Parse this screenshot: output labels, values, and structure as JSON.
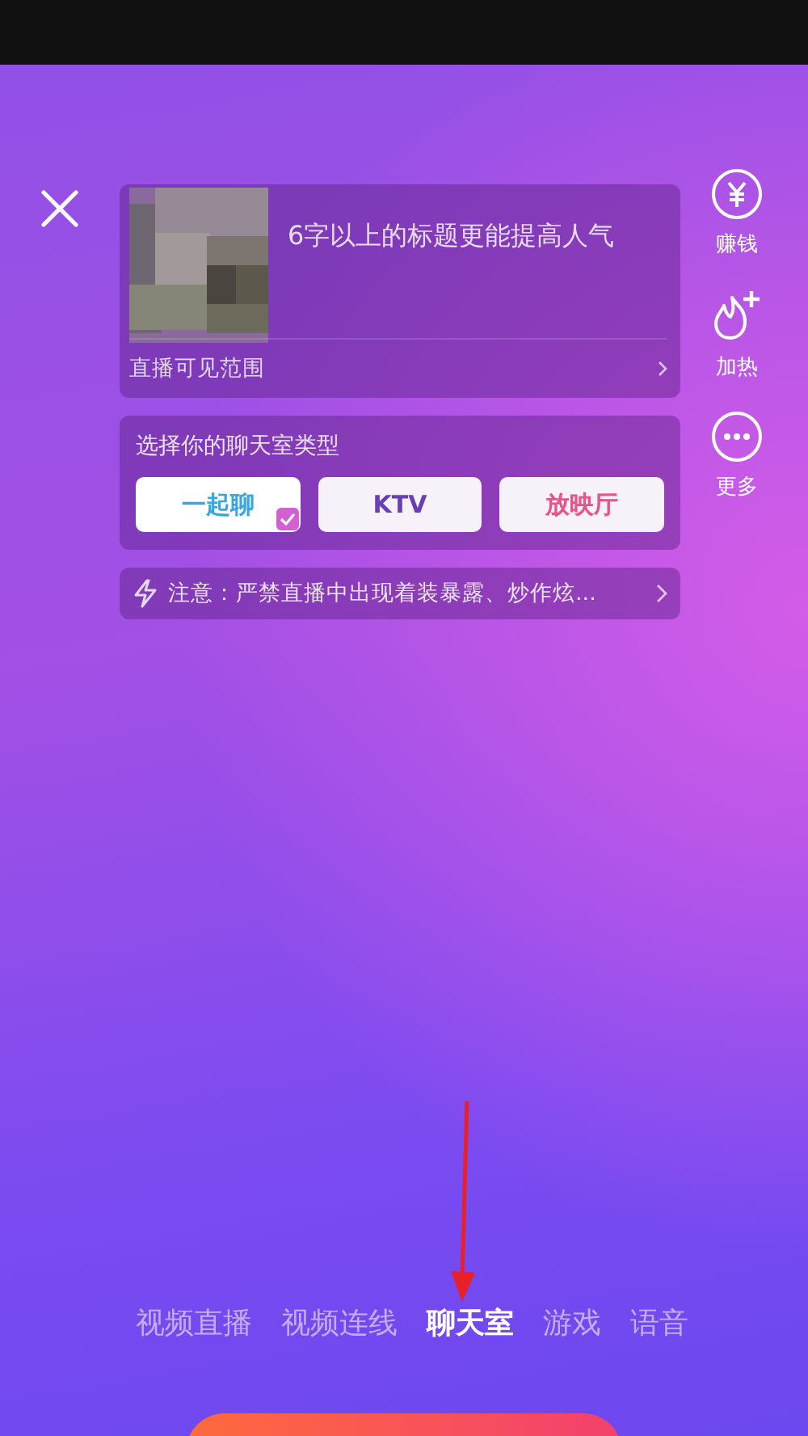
{
  "title_placeholder": "6字以上的标题更能提高人气",
  "visibility_label": "直播可见范围",
  "chat_type": {
    "heading": "选择你的聊天室类型",
    "options": [
      {
        "label": "一起聊",
        "color": "#3aa6dd",
        "selected": true
      },
      {
        "label": "KTV",
        "color": "#6a3fb5",
        "selected": false
      },
      {
        "label": "放映厅",
        "color": "#e8538a",
        "selected": false
      }
    ]
  },
  "notice": "注意：严禁直播中出现着装暴露、炒作炫...",
  "side_actions": [
    {
      "kind": "money",
      "label": "赚钱"
    },
    {
      "kind": "boost",
      "label": "加热"
    },
    {
      "kind": "more",
      "label": "更多"
    }
  ],
  "mode_tabs": [
    {
      "label": "视频直播",
      "selected": false
    },
    {
      "label": "视频连线",
      "selected": false
    },
    {
      "label": "聊天室",
      "selected": true
    },
    {
      "label": "游戏",
      "selected": false
    },
    {
      "label": "语音",
      "selected": false
    }
  ]
}
